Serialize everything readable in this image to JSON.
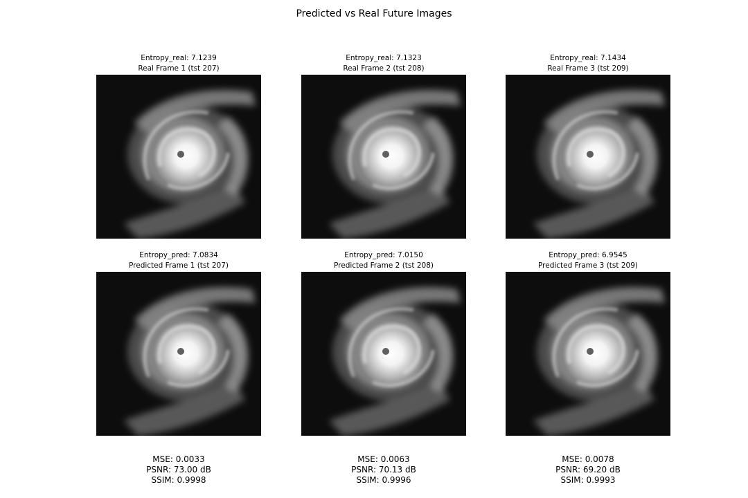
{
  "figure": {
    "title": "Predicted vs Real Future Images"
  },
  "real_frames": [
    {
      "entropy": "Entropy_real: 7.1239",
      "label": "Real Frame 1 (tst 207)"
    },
    {
      "entropy": "Entropy_real: 7.1323",
      "label": "Real Frame 2 (tst 208)"
    },
    {
      "entropy": "Entropy_real: 7.1434",
      "label": "Real Frame 3 (tst 209)"
    }
  ],
  "pred_frames": [
    {
      "entropy": "Entropy_pred: 7.0834",
      "label": "Predicted Frame 1 (tst 207)"
    },
    {
      "entropy": "Entropy_pred: 7.0150",
      "label": "Predicted Frame 2 (tst 208)"
    },
    {
      "entropy": "Entropy_pred: 6.9545",
      "label": "Predicted Frame 3 (tst 209)"
    }
  ],
  "metrics": [
    {
      "mse": "MSE: 0.0033",
      "psnr": "PSNR: 73.00 dB",
      "ssim": "SSIM: 0.9998"
    },
    {
      "mse": "MSE: 0.0063",
      "psnr": "PSNR: 70.13 dB",
      "ssim": "SSIM: 0.9996"
    },
    {
      "mse": "MSE: 0.0078",
      "psnr": "PSNR: 69.20 dB",
      "ssim": "SSIM: 0.9993"
    }
  ],
  "colors": {
    "background": "#ffffff",
    "image_background": "#0d0d0d",
    "cloud": "#ffffff"
  },
  "image_content": "grayscale satellite image of a hurricane"
}
